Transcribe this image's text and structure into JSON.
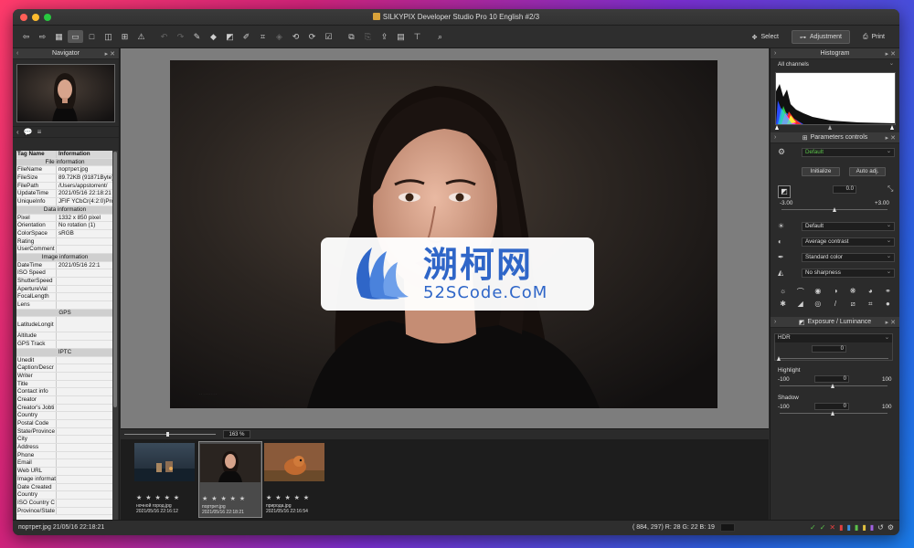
{
  "window": {
    "title": "SILKYPIX Developer Studio Pro 10 English   #2/3"
  },
  "toolbar": {
    "mode_select": "Select",
    "mode_adjustment": "Adjustment",
    "mode_print": "Print"
  },
  "navigator": {
    "title": "Navigator"
  },
  "info_table": {
    "col_tag": "Tag Name",
    "col_info": "Information",
    "rows": [
      {
        "type": "sec",
        "k": "File information"
      },
      {
        "k": "FileName",
        "v": "портрет.jpg"
      },
      {
        "k": "FileSize",
        "v": "89.72KB (91871Byte)"
      },
      {
        "k": "FilePath",
        "v": "/Users/appstorrent/"
      },
      {
        "k": "UpdateTime",
        "v": "2021/05/16 22:18:21"
      },
      {
        "k": "UniqueInfo",
        "v": "JFIF YCbCr(4:2:0)Pro"
      },
      {
        "type": "sec",
        "k": "Data information"
      },
      {
        "k": "Pixel",
        "v": "1332 x 850 pixel"
      },
      {
        "k": "Orientation",
        "v": "No rotation (1)"
      },
      {
        "k": "ColorSpace",
        "v": "sRGB"
      },
      {
        "k": "Rating",
        "v": ""
      },
      {
        "k": "UserComment",
        "v": ""
      },
      {
        "type": "sec",
        "k": "Image information"
      },
      {
        "k": "DateTime",
        "v": "2021/05/16 22:1"
      },
      {
        "k": "ISO Speed",
        "v": ""
      },
      {
        "k": "ShutterSpeed",
        "v": ""
      },
      {
        "k": "ApertureVal",
        "v": ""
      },
      {
        "k": "FocalLength",
        "v": ""
      },
      {
        "k": "Lens",
        "v": ""
      },
      {
        "type": "sec",
        "k": "GPS"
      },
      {
        "type": "tall",
        "k": "LatitudeLongit",
        "v": ""
      },
      {
        "k": "Altitude",
        "v": ""
      },
      {
        "k": "GPS Track",
        "v": ""
      },
      {
        "type": "sec",
        "k": "IPTC"
      },
      {
        "k": "Unedit",
        "v": ""
      },
      {
        "k": "Caption/Descr",
        "v": ""
      },
      {
        "k": "Writer",
        "v": ""
      },
      {
        "k": "Title",
        "v": ""
      },
      {
        "k": "Contact info",
        "v": ""
      },
      {
        "k": "Creator",
        "v": ""
      },
      {
        "k": "Creator's Jobti",
        "v": ""
      },
      {
        "k": "Country",
        "v": ""
      },
      {
        "k": "Postal Code",
        "v": ""
      },
      {
        "k": "State/Province",
        "v": ""
      },
      {
        "k": "City",
        "v": ""
      },
      {
        "k": "Address",
        "v": ""
      },
      {
        "k": "Phone",
        "v": ""
      },
      {
        "k": "Email",
        "v": ""
      },
      {
        "k": "Web URL",
        "v": ""
      },
      {
        "k": "Image information",
        "v": ""
      },
      {
        "k": "Date Created",
        "v": ""
      },
      {
        "k": "Country",
        "v": ""
      },
      {
        "k": "ISO Country C",
        "v": ""
      },
      {
        "k": "Province/State",
        "v": ""
      }
    ]
  },
  "viewer": {
    "zoom": "163 %"
  },
  "filmstrip": [
    {
      "name": "ночной город.jpg",
      "date": "2021/05/16 22:16:12",
      "stars": "★ ★ ★ ★ ★"
    },
    {
      "name": "портрет.jpg",
      "date": "2021/05/16 22:18:21",
      "stars": "★ ★ ★ ★ ★"
    },
    {
      "name": "природа.jpg",
      "date": "2021/05/16 22:16:54",
      "stars": "★ ★ ★ ★ ★"
    }
  ],
  "histogram": {
    "title": "Histogram",
    "channel": "All channels"
  },
  "params": {
    "title": "Parameters controls",
    "preset": "Default",
    "initialize": "Initialize",
    "auto_adj": "Auto adj.",
    "exposure_value": "0.0",
    "exp_min": "-3.00",
    "exp_max": "+3.00",
    "white_balance": "Default",
    "tone": "Average contrast",
    "color": "Standard color",
    "sharpness": "No sharpness"
  },
  "exposure_panel": {
    "title": "Exposure / Luminance",
    "hdr_label": "HDR",
    "hdr_value": "0",
    "highlight_label": "Highlight",
    "highlight_min": "-100",
    "highlight_max": "100",
    "highlight_value": "0",
    "shadow_label": "Shadow",
    "shadow_min": "-100",
    "shadow_max": "100",
    "shadow_value": "0"
  },
  "status": {
    "file": "портрет.jpg 21/05/16 22:18:21",
    "coords": "( 884, 297) R: 28 G: 22 B: 19"
  },
  "watermark": {
    "cn": "溯柯网",
    "en": "52SCode.CoM"
  },
  "colors": {
    "accent": "#2f66c8",
    "panel": "#2b2b2b",
    "green_text": "#5bc24a"
  }
}
